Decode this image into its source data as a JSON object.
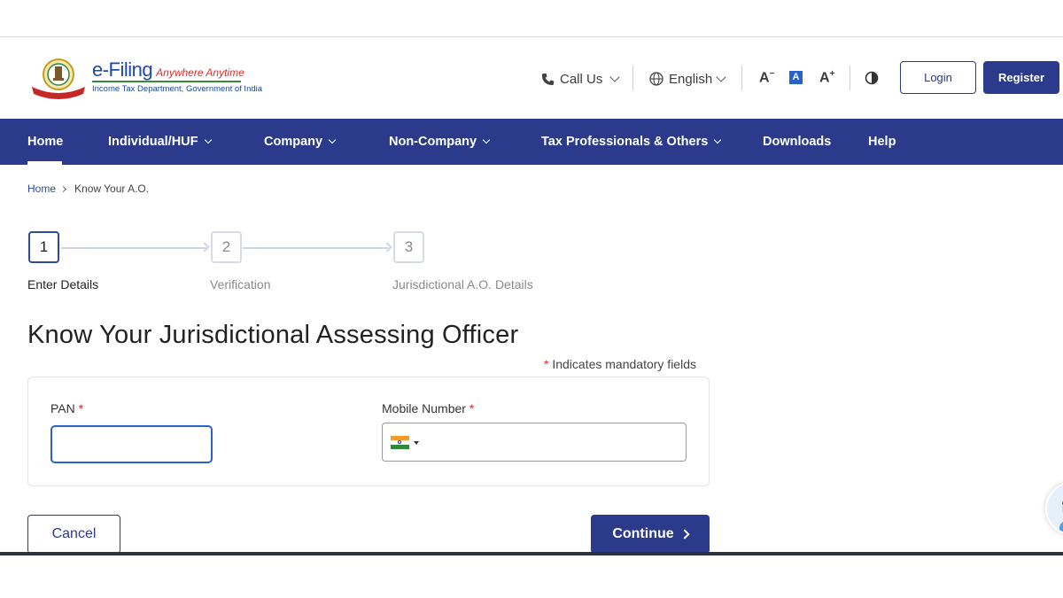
{
  "header": {
    "logo": {
      "brand": "e-Filing",
      "tagline": "Anywhere Anytime",
      "subtitle": "Income Tax Department, Government of India"
    },
    "call_us": "Call Us",
    "language": "English",
    "font_decrease": "A",
    "font_reset": "A",
    "font_increase": "A",
    "login": "Login",
    "register": "Register"
  },
  "nav": {
    "items": [
      {
        "label": "Home"
      },
      {
        "label": "Individual/HUF"
      },
      {
        "label": "Company"
      },
      {
        "label": "Non-Company"
      },
      {
        "label": "Tax Professionals & Others"
      },
      {
        "label": "Downloads"
      },
      {
        "label": "Help"
      }
    ]
  },
  "breadcrumb": {
    "home": "Home",
    "current": "Know Your A.O."
  },
  "stepper": {
    "steps": [
      {
        "number": "1",
        "label": "Enter Details"
      },
      {
        "number": "2",
        "label": "Verification"
      },
      {
        "number": "3",
        "label": "Jurisdictional A.O. Details"
      }
    ]
  },
  "page": {
    "title": "Know Your Jurisdictional Assessing Officer",
    "mandatory_star": "*",
    "mandatory_note": " Indicates mandatory fields"
  },
  "form": {
    "pan_label": "PAN",
    "pan_value": "",
    "mobile_label": "Mobile Number",
    "mobile_value": "",
    "required_mark": "*"
  },
  "actions": {
    "cancel": "Cancel",
    "continue": "Continue"
  },
  "colors": {
    "primary": "#2b3a8a",
    "accent_blue": "#2962c9",
    "required": "#d32f2f"
  }
}
